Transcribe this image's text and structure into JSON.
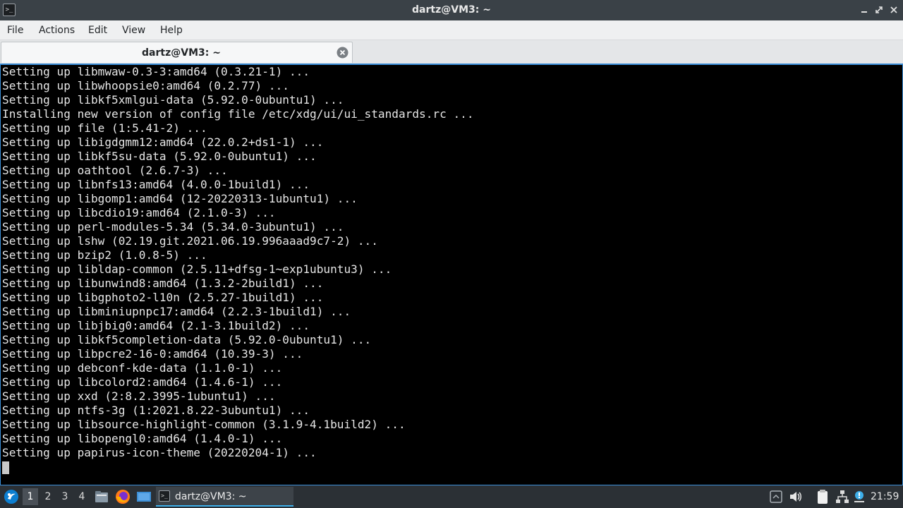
{
  "window": {
    "title": "dartz@VM3: ~",
    "icon": "terminal-icon",
    "controls": [
      "minimize-icon",
      "maximize-icon",
      "close-icon"
    ]
  },
  "menubar": {
    "items": [
      "File",
      "Actions",
      "Edit",
      "View",
      "Help"
    ]
  },
  "tabs": [
    {
      "label": "dartz@VM3: ~",
      "close_icon": "close-circle-icon",
      "active": true
    }
  ],
  "terminal": {
    "lines": [
      "Setting up libmwaw-0.3-3:amd64 (0.3.21-1) ...",
      "Setting up libwhoopsie0:amd64 (0.2.77) ...",
      "Setting up libkf5xmlgui-data (5.92.0-0ubuntu1) ...",
      "Installing new version of config file /etc/xdg/ui/ui_standards.rc ...",
      "Setting up file (1:5.41-2) ...",
      "Setting up libigdgmm12:amd64 (22.0.2+ds1-1) ...",
      "Setting up libkf5su-data (5.92.0-0ubuntu1) ...",
      "Setting up oathtool (2.6.7-3) ...",
      "Setting up libnfs13:amd64 (4.0.0-1build1) ...",
      "Setting up libgomp1:amd64 (12-20220313-1ubuntu1) ...",
      "Setting up libcdio19:amd64 (2.1.0-3) ...",
      "Setting up perl-modules-5.34 (5.34.0-3ubuntu1) ...",
      "Setting up lshw (02.19.git.2021.06.19.996aaad9c7-2) ...",
      "Setting up bzip2 (1.0.8-5) ...",
      "Setting up libldap-common (2.5.11+dfsg-1~exp1ubuntu3) ...",
      "Setting up libunwind8:amd64 (1.3.2-2build1) ...",
      "Setting up libgphoto2-l10n (2.5.27-1build1) ...",
      "Setting up libminiupnpc17:amd64 (2.2.3-1build1) ...",
      "Setting up libjbig0:amd64 (2.1-3.1build2) ...",
      "Setting up libkf5completion-data (5.92.0-0ubuntu1) ...",
      "Setting up libpcre2-16-0:amd64 (10.39-3) ...",
      "Setting up debconf-kde-data (1.1.0-1) ...",
      "Setting up libcolord2:amd64 (1.4.6-1) ...",
      "Setting up xxd (2:8.2.3995-1ubuntu1) ...",
      "Setting up ntfs-3g (1:2021.8.22-3ubuntu1) ...",
      "Setting up libsource-highlight-common (3.1.9-4.1build2) ...",
      "Setting up libopengl0:amd64 (1.4.0-1) ...",
      "Setting up papirus-icon-theme (20220204-1) ..."
    ],
    "colors": {
      "background": "#000000",
      "foreground": "#e6e6e6",
      "border": "#3b8ed8"
    }
  },
  "taskbar": {
    "start_icon": "lubuntu-start-icon",
    "workspaces": [
      "1",
      "2",
      "3",
      "4"
    ],
    "active_workspace": "1",
    "launchers": [
      "file-manager-icon",
      "firefox-icon",
      "show-desktop-icon"
    ],
    "tasks": [
      {
        "label": "dartz@VM3: ~",
        "icon": "terminal-icon"
      }
    ],
    "tray": [
      "tray-expand-icon",
      "volume-icon",
      "clipboard-icon",
      "network-icon",
      "update-notifier-icon"
    ],
    "clock": "21:59",
    "accent": "#3daee9"
  }
}
